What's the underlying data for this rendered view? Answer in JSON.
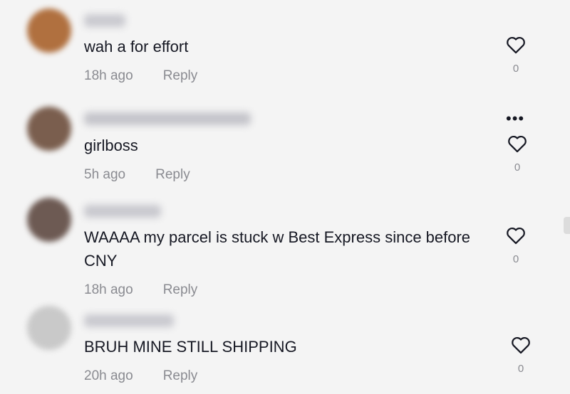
{
  "comments": [
    {
      "text": "wah a for effort",
      "time": "18h ago",
      "reply_label": "Reply",
      "likes": "0",
      "avatar_color": "#b0703f",
      "username_color": "#c9c9cf"
    },
    {
      "text": "girlboss",
      "time": "5h ago",
      "reply_label": "Reply",
      "likes": "0",
      "avatar_color": "#7a5e4e",
      "username_color": "#c4c4ca"
    },
    {
      "text": "WAAAA my parcel is stuck w Best Express since before CNY",
      "time": "18h ago",
      "reply_label": "Reply",
      "likes": "0",
      "avatar_color": "#6d5a53",
      "username_color": "#c8c8ce"
    },
    {
      "text": "BRUH MINE STILL SHIPPING",
      "time": "20h ago",
      "reply_label": "Reply",
      "likes": "0",
      "avatar_color": "#c9c9c9",
      "username_color": "#c9c9cf"
    }
  ],
  "icons": {
    "like": "heart-outline-icon",
    "more": "more-options-icon"
  },
  "more_label": "•••"
}
